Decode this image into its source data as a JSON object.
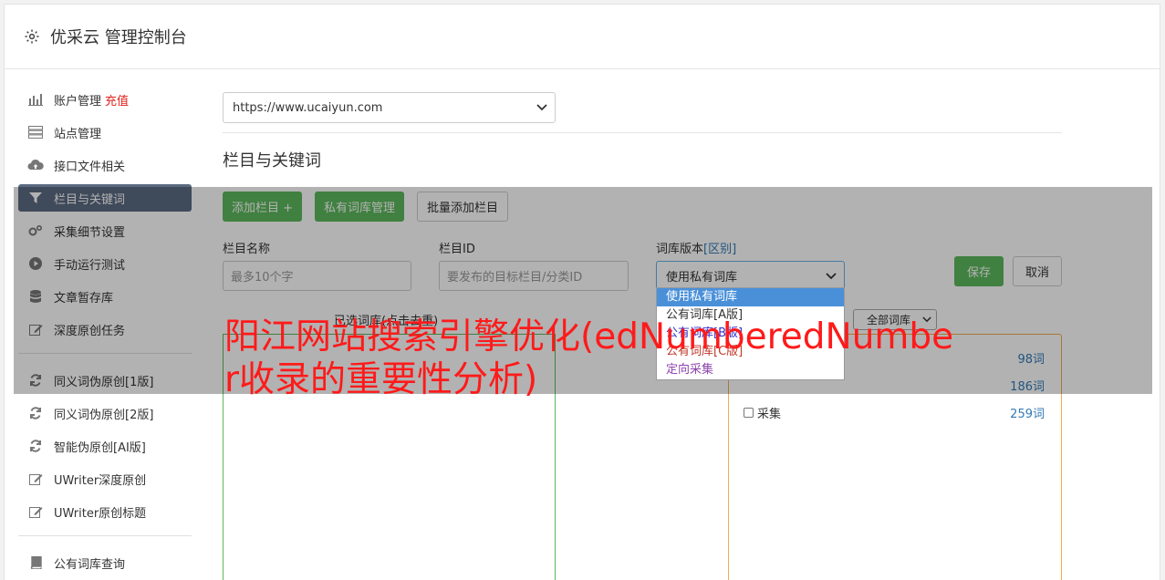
{
  "header": {
    "title": "优采云 管理控制台",
    "icon": "gear-icon"
  },
  "sidebar": {
    "items": [
      {
        "label": "账户管理",
        "accent": "充值",
        "icon": "bar-chart-icon"
      },
      {
        "label": "站点管理",
        "icon": "server-icon"
      },
      {
        "label": "接口文件相关",
        "icon": "cloud-upload-icon"
      },
      {
        "label": "栏目与关键词",
        "icon": "filter-icon",
        "active": true
      },
      {
        "label": "采集细节设置",
        "icon": "cogs-icon"
      },
      {
        "label": "手动运行测试",
        "icon": "play-icon"
      },
      {
        "label": "文章暂存库",
        "icon": "database-icon"
      },
      {
        "label": "深度原创任务",
        "icon": "edit-icon"
      }
    ],
    "items2": [
      {
        "label": "同义词伪原创[1版]",
        "icon": "refresh-icon"
      },
      {
        "label": "同义词伪原创[2版]",
        "icon": "refresh-icon"
      },
      {
        "label": "智能伪原创[AI版]",
        "icon": "refresh-icon"
      },
      {
        "label": "UWriter深度原创",
        "icon": "edit-icon"
      },
      {
        "label": "UWriter原创标题",
        "icon": "edit-icon"
      }
    ],
    "items3": [
      {
        "label": "公有词库查询",
        "icon": "book-icon"
      }
    ]
  },
  "main": {
    "site_select": "https://www.ucaiyun.com",
    "section_title": "栏目与关键词",
    "buttons": {
      "add": "添加栏目 +",
      "private": "私有词库管理",
      "batch": "批量添加栏目"
    },
    "form": {
      "name_label": "栏目名称",
      "name_placeholder": "最多10个字",
      "id_label": "栏目ID",
      "id_placeholder": "要发布的目标栏目/分类ID",
      "lib_label": "词库版本",
      "lib_label_link": "[区别]",
      "lib_value": "使用私有词库",
      "save": "保存",
      "cancel": "取消"
    },
    "dropdown_options": [
      "使用私有词库",
      "公有词库[A版]",
      "公有词库[B版]",
      "公有词库[C版]",
      "定向采集"
    ],
    "selected_label": "已选词库(点击去重)",
    "filter_select": "全部词库",
    "libraries": [
      {
        "name": "",
        "count": "98词"
      },
      {
        "name": "",
        "count": "186词"
      },
      {
        "name": "采集",
        "count": "259词"
      }
    ]
  },
  "overlay_headline": "阳江网站搜索引擎优化(edNumberedNumber收录的重要性分析)",
  "colors": {
    "accent_red": "#e0201a",
    "green": "#5cb85c",
    "orange": "#f0ad4e",
    "active_nav": "#5b6a81",
    "headline": "#ff1a1a"
  }
}
